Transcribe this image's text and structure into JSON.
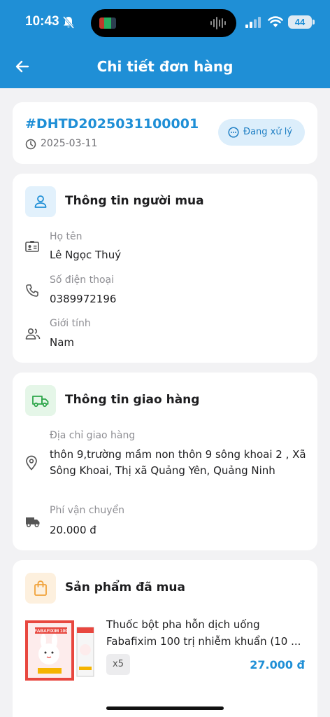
{
  "status_bar": {
    "time": "10:43",
    "battery": "44"
  },
  "nav": {
    "title": "Chi tiết đơn hàng"
  },
  "order": {
    "id": "#DHTD2025031100001",
    "date": "2025-03-11",
    "status": "Đang xử lý"
  },
  "buyer": {
    "title": "Thông tin người mua",
    "name_label": "Họ tên",
    "name": "Lê Ngọc Thuý",
    "phone_label": "Số điện thoại",
    "phone": "0389972196",
    "gender_label": "Giới tính",
    "gender": "Nam"
  },
  "delivery": {
    "title": "Thông tin giao hàng",
    "address_label": "Địa chỉ giao hàng",
    "address": "thôn 9,trường mầm non thôn 9 sông khoai 2 , Xã Sông Khoai, Thị xã Quảng Yên, Quảng Ninh",
    "fee_label": "Phí vận chuyển",
    "fee": "20.000 đ"
  },
  "products": {
    "title": "Sản phẩm đã mua",
    "items": [
      {
        "name": "Thuốc bột pha hỗn dịch uống Fabafixim 100 trị nhiễm khuẩn (10 ...",
        "qty": "x5",
        "price": "27.000 đ",
        "brand": "FABAFIXIM 100"
      }
    ]
  },
  "colors": {
    "primary": "#1f8fd6",
    "buyer_icon_bg": "#e2f1fc",
    "delivery_icon_bg": "#e5f6e8",
    "product_icon_bg": "#fdf0de"
  },
  "icons": [
    "bell-slash-icon",
    "signal-icon",
    "wifi-icon",
    "back-arrow-icon",
    "clock-icon",
    "more-circle-icon",
    "person-icon",
    "id-card-icon",
    "phone-icon",
    "people-icon",
    "truck-icon",
    "location-pin-icon",
    "shopping-bag-icon"
  ]
}
